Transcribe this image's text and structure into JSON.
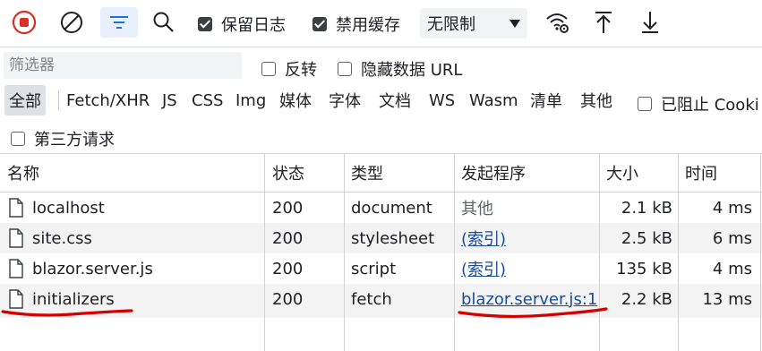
{
  "toolbar": {
    "preserve_log": {
      "label": "保留日志",
      "checked": true
    },
    "disable_cache": {
      "label": "禁用缓存",
      "checked": true
    },
    "throttle": {
      "value": "无限制"
    }
  },
  "filter": {
    "placeholder": "筛选器",
    "invert": {
      "label": "反转",
      "checked": false
    },
    "hide_data_urls": {
      "label": "隐藏数据 URL",
      "checked": false
    }
  },
  "types": [
    "全部",
    "Fetch/XHR",
    "JS",
    "CSS",
    "Img",
    "媒体",
    "字体",
    "文档",
    "WS",
    "Wasm",
    "清单",
    "其他"
  ],
  "blocked_cookies": {
    "label": "已阻止 Cooki",
    "checked": false
  },
  "third_party": {
    "label": "第三方请求",
    "checked": false
  },
  "table": {
    "headers": {
      "name": "名称",
      "status": "状态",
      "type": "类型",
      "initiator": "发起程序",
      "size": "大小",
      "time": "时间"
    },
    "rows": [
      {
        "name": "localhost",
        "status": "200",
        "type": "document",
        "initiator": "其他",
        "initiator_link": false,
        "size": "2.1 kB",
        "time": "4 ms"
      },
      {
        "name": "site.css",
        "status": "200",
        "type": "stylesheet",
        "initiator": "(索引)",
        "initiator_link": true,
        "size": "2.5 kB",
        "time": "6 ms"
      },
      {
        "name": "blazor.server.js",
        "status": "200",
        "type": "script",
        "initiator": "(索引)",
        "initiator_link": true,
        "size": "135 kB",
        "time": "4 ms"
      },
      {
        "name": "initializers",
        "status": "200",
        "type": "fetch",
        "initiator": "blazor.server.js:1",
        "initiator_link": true,
        "size": "2.2 kB",
        "time": "13 ms"
      }
    ]
  },
  "colors": {
    "record": "#d93025",
    "active_filter": "#1a73e8",
    "link": "#1a4b9c",
    "annotation": "#d40000"
  }
}
